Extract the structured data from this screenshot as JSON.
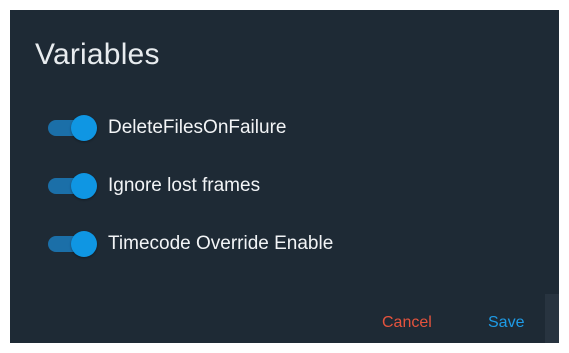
{
  "dialog": {
    "title": "Variables",
    "options": [
      {
        "label": "DeleteFilesOnFailure",
        "enabled": true
      },
      {
        "label": "Ignore lost frames",
        "enabled": true
      },
      {
        "label": "Timecode Override Enable",
        "enabled": true
      }
    ],
    "actions": {
      "cancel_label": "Cancel",
      "save_label": "Save"
    }
  },
  "colors": {
    "dialog_bg": "#1e2a35",
    "toggle_on": "#0f96e3",
    "cancel": "#e5533d",
    "save": "#1e9be6"
  },
  "icons": {
    "toggle": "toggle-switch-on-icon"
  }
}
